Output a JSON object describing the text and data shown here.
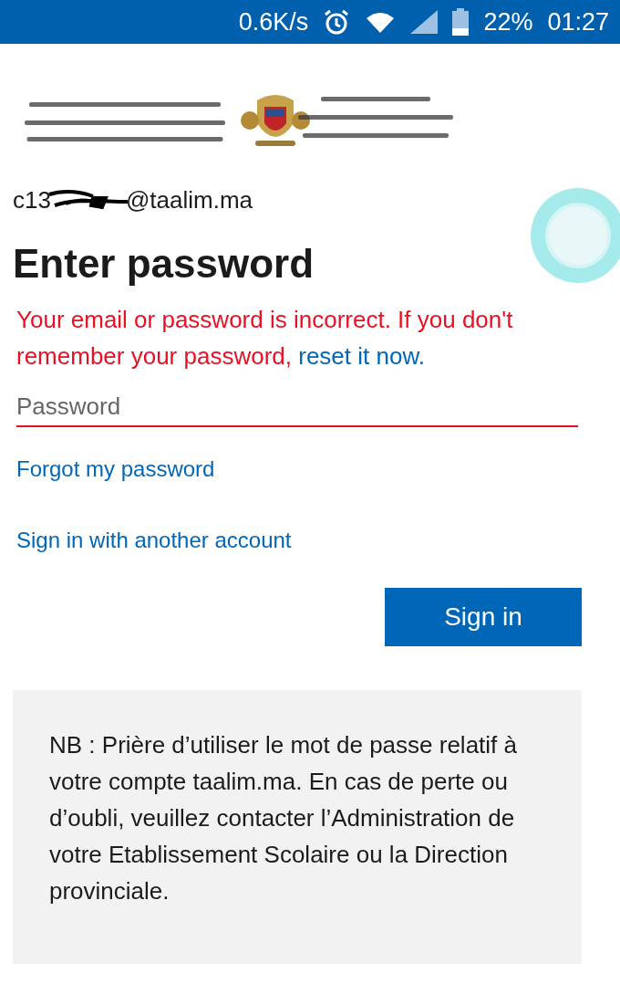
{
  "status_bar": {
    "speed": "0.6K/s",
    "battery": "22%",
    "time": "01:27"
  },
  "account": {
    "email_start": "c13",
    "email_end": "@taalim.ma"
  },
  "title": "Enter password",
  "error": {
    "text": "Your email or password is incorrect. If you don't remember your password,",
    "link": "reset it now."
  },
  "password_field": {
    "placeholder": "Password",
    "invalid": true
  },
  "links": [
    "Forgot my password",
    "Sign in with another account"
  ],
  "sign_in_button": "Sign in",
  "note": "NB : Prière d’utiliser le mot de passe relatif à votre compte taalim.ma. En cas de perte ou d’oubli, veuillez contacter l’Administration de votre Etablissement Scolaire ou la Direction provinciale."
}
